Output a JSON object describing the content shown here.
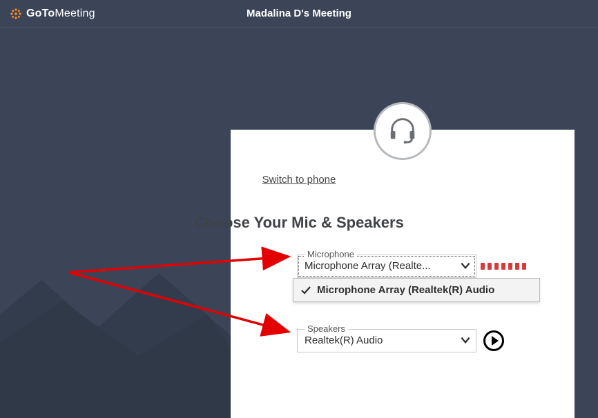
{
  "logo": {
    "bold": "GoTo",
    "thin": "Meeting"
  },
  "meeting_title": "Madalina D's Meeting",
  "switch_to_phone": "Switch to phone",
  "panel_title": "Choose Your Mic & Speakers",
  "microphone": {
    "label": "Microphone",
    "selected": "Microphone Array (Realte...",
    "options": [
      {
        "label": "Microphone Array (Realtek(R) Audio",
        "selected": true
      }
    ]
  },
  "speakers": {
    "label": "Speakers",
    "selected": "Realtek(R) Audio"
  }
}
